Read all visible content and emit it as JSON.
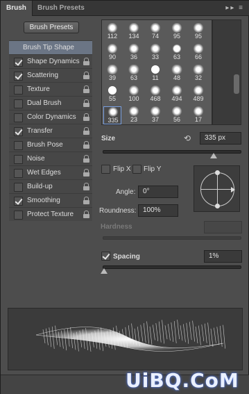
{
  "tabs": [
    {
      "label": "Brush",
      "active": true
    },
    {
      "label": "Brush Presets",
      "active": false
    }
  ],
  "tab_icons": "▸▸ ≡",
  "brush_presets_button": "Brush Presets",
  "brush_tip_shape": "Brush Tip Shape",
  "options": [
    {
      "label": "Shape Dynamics",
      "checked": true,
      "locked": true
    },
    {
      "label": "Scattering",
      "checked": true,
      "locked": true
    },
    {
      "label": "Texture",
      "checked": false,
      "locked": true
    },
    {
      "label": "Dual Brush",
      "checked": false,
      "locked": true
    },
    {
      "label": "Color Dynamics",
      "checked": false,
      "locked": true
    },
    {
      "label": "Transfer",
      "checked": true,
      "locked": true
    },
    {
      "label": "Brush Pose",
      "checked": false,
      "locked": true
    },
    {
      "label": "Noise",
      "checked": false,
      "locked": true
    },
    {
      "label": "Wet Edges",
      "checked": false,
      "locked": true
    },
    {
      "label": "Build-up",
      "checked": false,
      "locked": true
    },
    {
      "label": "Smoothing",
      "checked": true,
      "locked": true
    },
    {
      "label": "Protect Texture",
      "checked": false,
      "locked": true
    }
  ],
  "brush_grid": [
    [
      "112",
      "134",
      "74",
      "95",
      "95"
    ],
    [
      "90",
      "36",
      "33",
      "63",
      "66"
    ],
    [
      "39",
      "63",
      "11",
      "48",
      "32"
    ],
    [
      "55",
      "100",
      "468",
      "494",
      "489"
    ],
    [
      "335",
      "23",
      "37",
      "56",
      "17"
    ]
  ],
  "selected_brush": "335",
  "size_label": "Size",
  "size_value": "335 px",
  "size_slider_fraction": 0.8,
  "flip_x": {
    "label": "Flip X",
    "checked": false
  },
  "flip_y": {
    "label": "Flip Y",
    "checked": false
  },
  "angle_label": "Angle:",
  "angle_value": "0°",
  "roundness_label": "Roundness:",
  "roundness_value": "100%",
  "hardness_label": "Hardness",
  "spacing": {
    "label": "Spacing",
    "checked": true,
    "value": "1%",
    "slider_fraction": 0.01
  },
  "watermark": "UiBQ.CoM",
  "colors": {
    "panel": "#4d4d4d",
    "selected": "#6b7585",
    "accent": "#7aa0e0"
  }
}
